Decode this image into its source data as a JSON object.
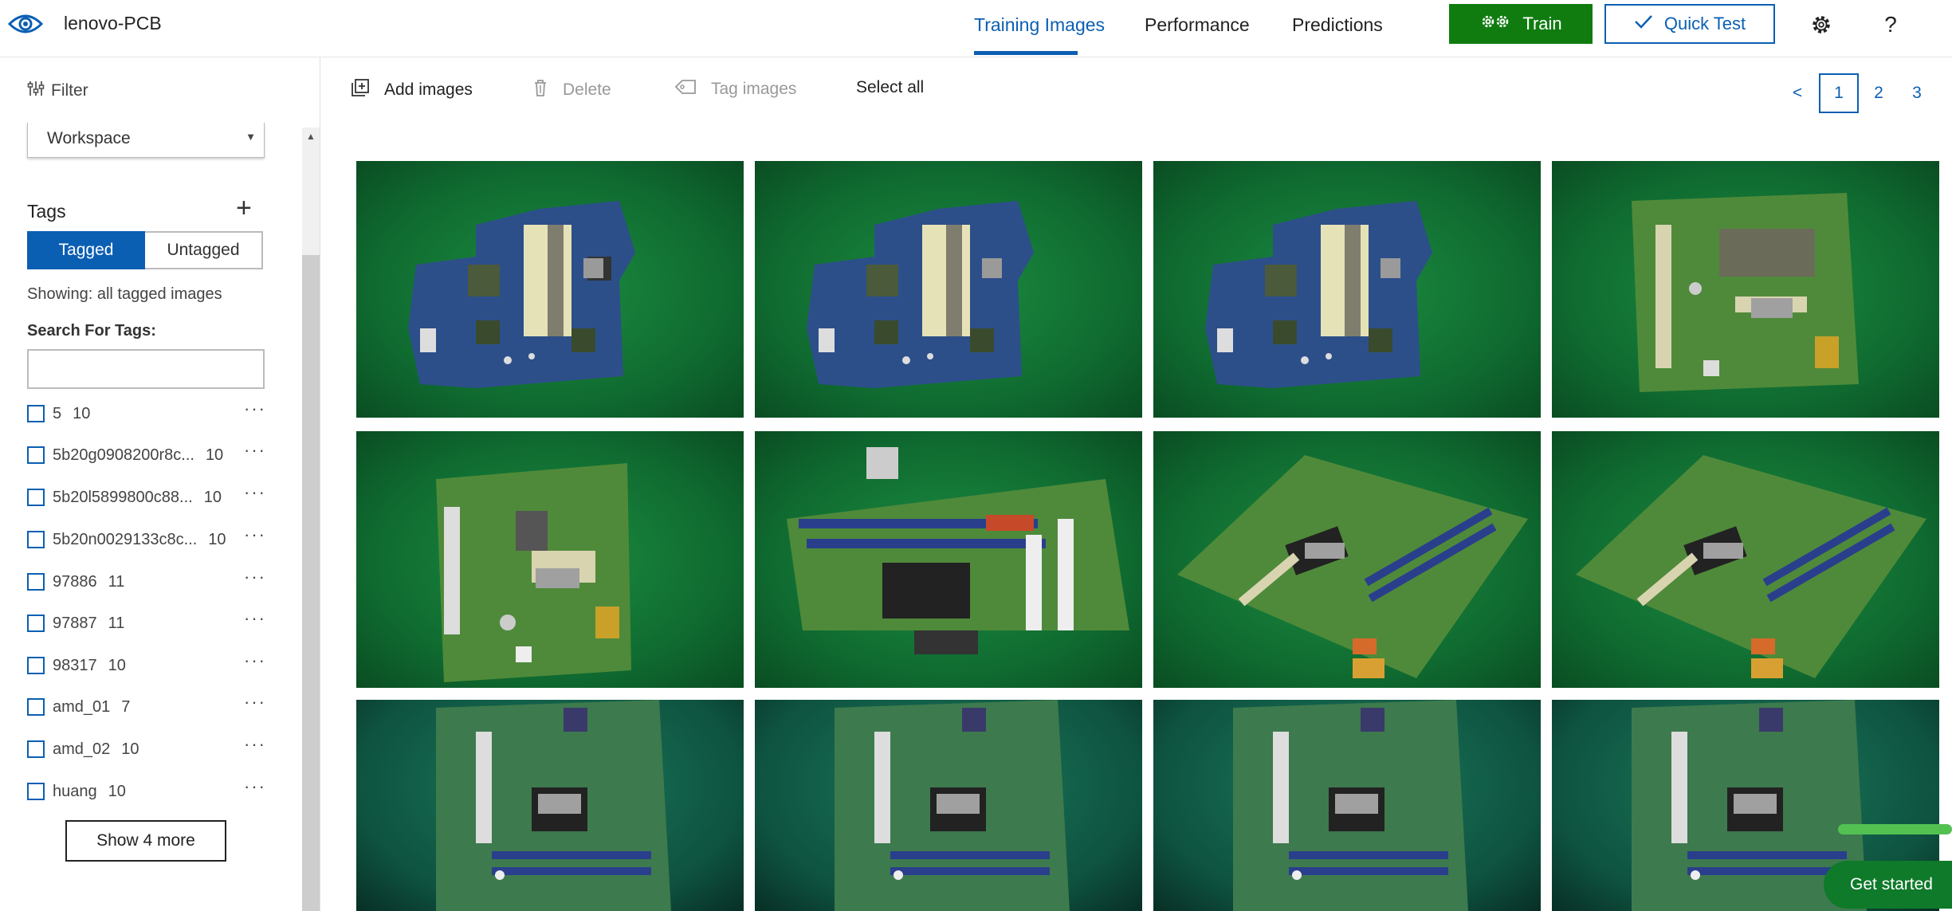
{
  "header": {
    "project_name": "lenovo-PCB",
    "tabs": [
      {
        "label": "Training Images",
        "active": true
      },
      {
        "label": "Performance",
        "active": false
      },
      {
        "label": "Predictions",
        "active": false
      }
    ],
    "train_label": "Train",
    "quick_test_label": "Quick Test",
    "settings_icon": "gear-icon",
    "help_label": "?"
  },
  "sidebar": {
    "filter_label": "Filter",
    "workspace_value": "Workspace",
    "tags_title": "Tags",
    "tagged_label": "Tagged",
    "untagged_label": "Untagged",
    "showing_text": "Showing: all tagged images",
    "search_label": "Search For Tags:",
    "search_value": "",
    "tags": [
      {
        "name": "5",
        "count": "10"
      },
      {
        "name": "5b20g0908200r8c...",
        "count": "10"
      },
      {
        "name": "5b20l5899800c88...",
        "count": "10"
      },
      {
        "name": "5b20n0029133c8c...",
        "count": "10"
      },
      {
        "name": "97886",
        "count": "11"
      },
      {
        "name": "97887",
        "count": "11"
      },
      {
        "name": "98317",
        "count": "10"
      },
      {
        "name": "amd_01",
        "count": "7"
      },
      {
        "name": "amd_02",
        "count": "10"
      },
      {
        "name": "huang",
        "count": "10"
      }
    ],
    "more_label": "···",
    "show_more_label": "Show 4 more"
  },
  "toolbar": {
    "add_images_label": "Add images",
    "delete_label": "Delete",
    "tag_images_label": "Tag images",
    "select_all_label": "Select all"
  },
  "pagination": {
    "prev_label": "<",
    "pages": [
      "1",
      "2",
      "3"
    ],
    "current": "1"
  },
  "gallery": {
    "images": [
      {
        "subject": "laptop-pcb-blue"
      },
      {
        "subject": "laptop-pcb-blue"
      },
      {
        "subject": "laptop-pcb-blue"
      },
      {
        "subject": "desktop-pcb-green"
      },
      {
        "subject": "desktop-pcb-green"
      },
      {
        "subject": "desktop-pcb-angled"
      },
      {
        "subject": "desktop-pcb-angled"
      },
      {
        "subject": "desktop-pcb-angled"
      },
      {
        "subject": "desktop-pcb-teal"
      },
      {
        "subject": "desktop-pcb-teal"
      },
      {
        "subject": "desktop-pcb-teal"
      },
      {
        "subject": "desktop-pcb-teal"
      }
    ]
  },
  "floating": {
    "get_started_label": "Get started"
  },
  "colors": {
    "accent": "#0b5fb3",
    "train": "#107c10",
    "get_started": "#0e7a2a"
  }
}
